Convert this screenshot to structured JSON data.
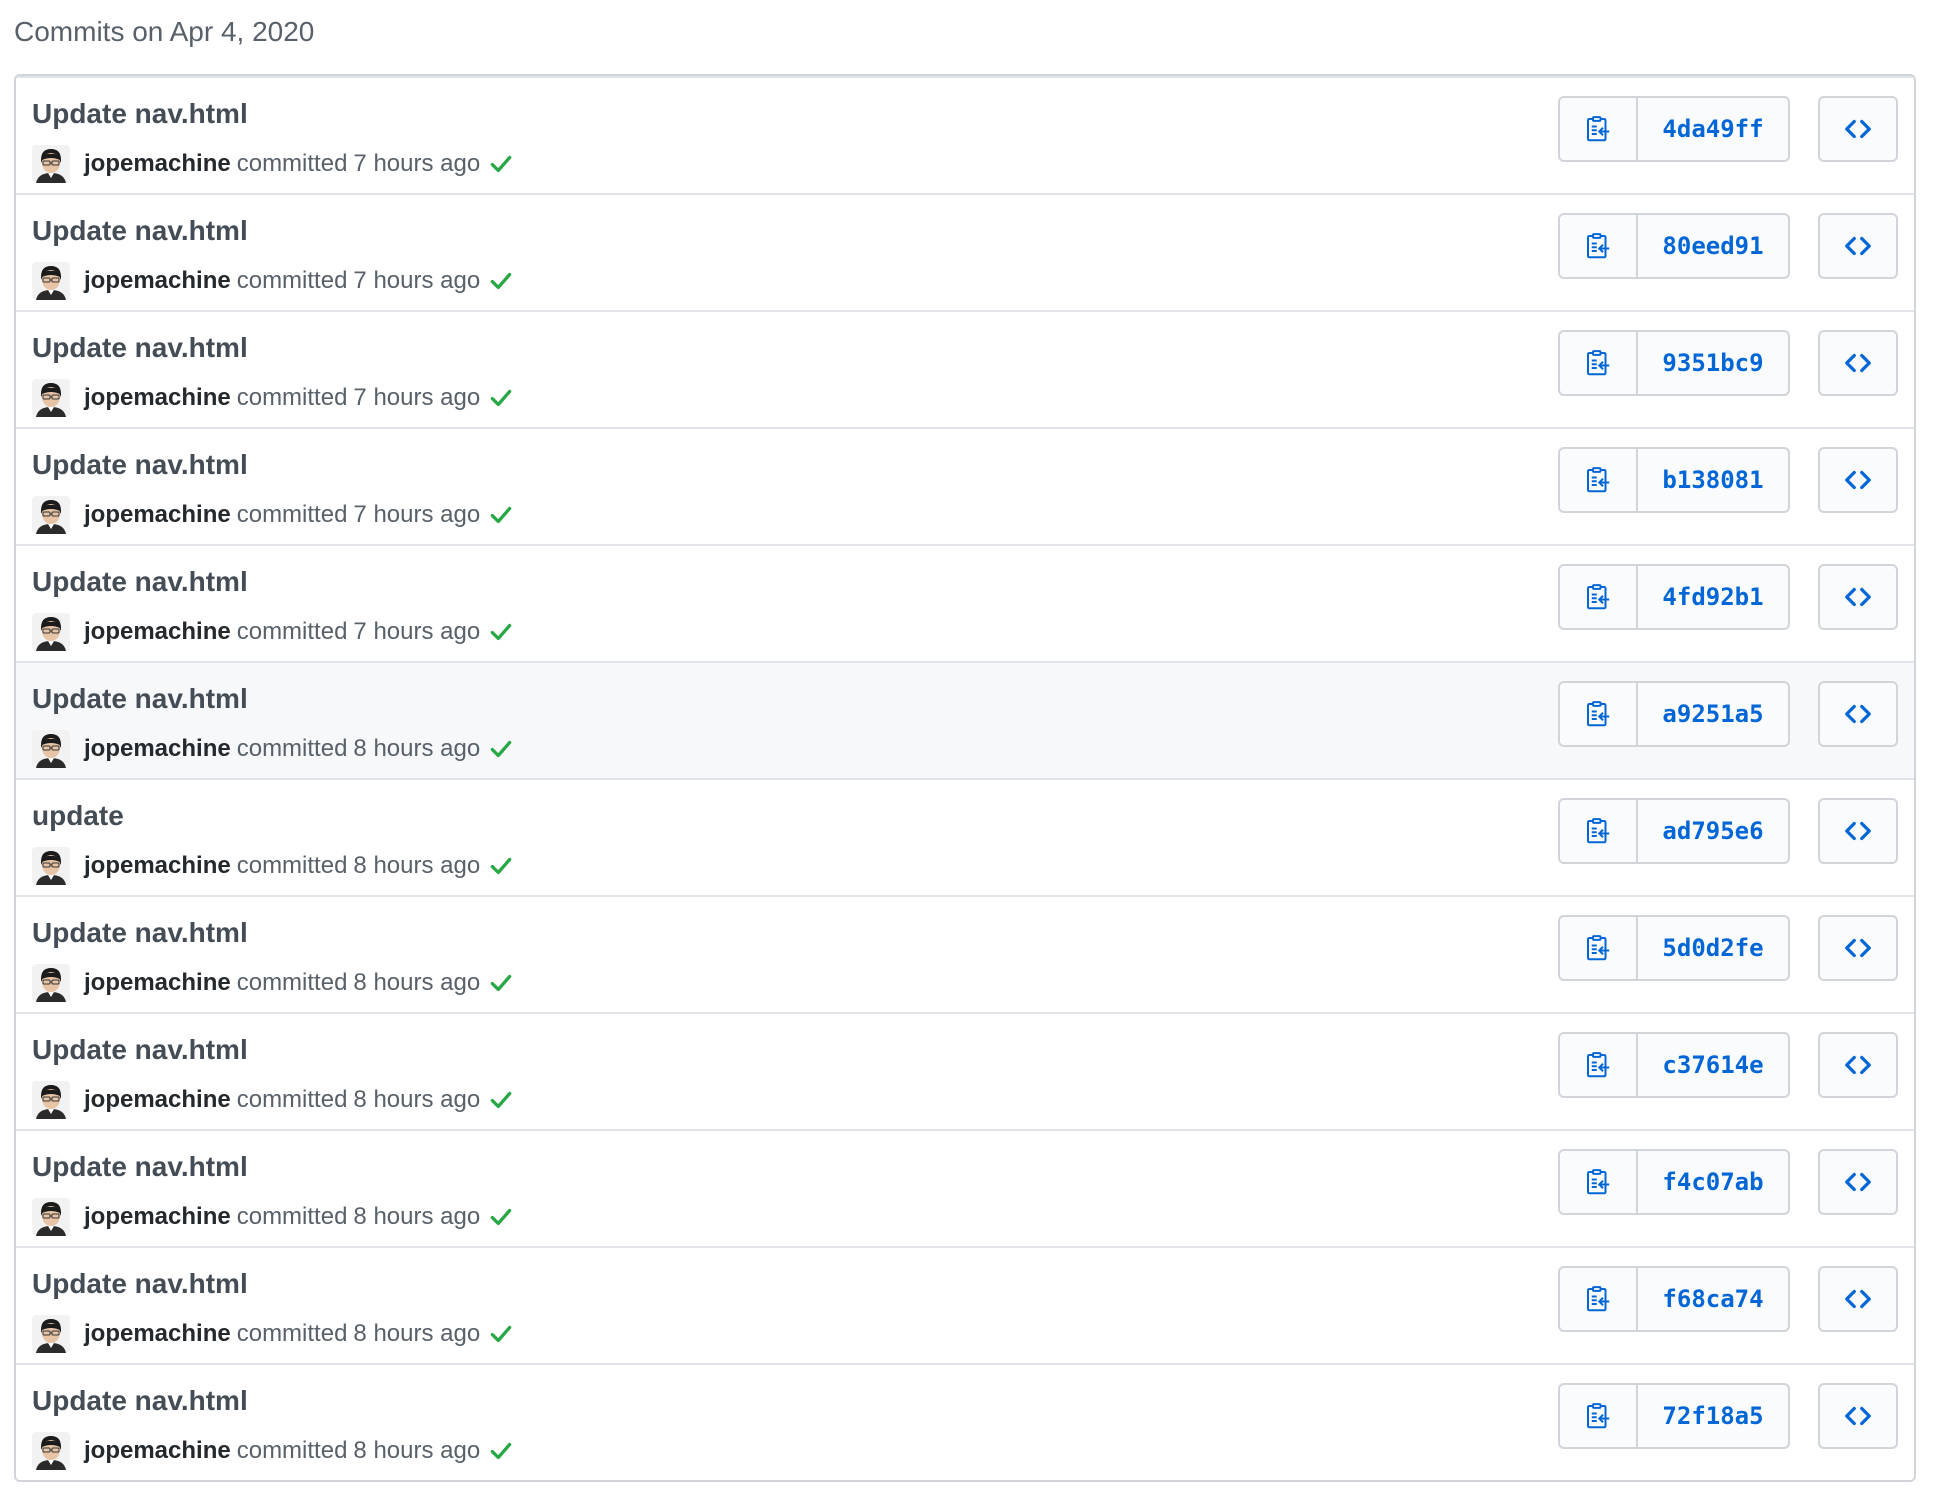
{
  "header": {
    "date_label": "Commits on Apr 4, 2020"
  },
  "colors": {
    "link": "#0366d6",
    "success": "#28a745",
    "border": "#d1d5da"
  },
  "icons": {
    "copy": "clippy-icon",
    "browse": "code-icon",
    "status": "check-icon"
  },
  "commits": [
    {
      "title": "Update nav.html",
      "author": "jopemachine",
      "action": "committed",
      "time": "7 hours ago",
      "sha": "4da49ff",
      "status": "success"
    },
    {
      "title": "Update nav.html",
      "author": "jopemachine",
      "action": "committed",
      "time": "7 hours ago",
      "sha": "80eed91",
      "status": "success"
    },
    {
      "title": "Update nav.html",
      "author": "jopemachine",
      "action": "committed",
      "time": "7 hours ago",
      "sha": "9351bc9",
      "status": "success"
    },
    {
      "title": "Update nav.html",
      "author": "jopemachine",
      "action": "committed",
      "time": "7 hours ago",
      "sha": "b138081",
      "status": "success"
    },
    {
      "title": "Update nav.html",
      "author": "jopemachine",
      "action": "committed",
      "time": "7 hours ago",
      "sha": "4fd92b1",
      "status": "success"
    },
    {
      "title": "Update nav.html",
      "author": "jopemachine",
      "action": "committed",
      "time": "8 hours ago",
      "sha": "a9251a5",
      "status": "success",
      "hovered": true
    },
    {
      "title": "update",
      "author": "jopemachine",
      "action": "committed",
      "time": "8 hours ago",
      "sha": "ad795e6",
      "status": "success"
    },
    {
      "title": "Update nav.html",
      "author": "jopemachine",
      "action": "committed",
      "time": "8 hours ago",
      "sha": "5d0d2fe",
      "status": "success"
    },
    {
      "title": "Update nav.html",
      "author": "jopemachine",
      "action": "committed",
      "time": "8 hours ago",
      "sha": "c37614e",
      "status": "success"
    },
    {
      "title": "Update nav.html",
      "author": "jopemachine",
      "action": "committed",
      "time": "8 hours ago",
      "sha": "f4c07ab",
      "status": "success"
    },
    {
      "title": "Update nav.html",
      "author": "jopemachine",
      "action": "committed",
      "time": "8 hours ago",
      "sha": "f68ca74",
      "status": "success"
    },
    {
      "title": "Update nav.html",
      "author": "jopemachine",
      "action": "committed",
      "time": "8 hours ago",
      "sha": "72f18a5",
      "status": "success"
    }
  ]
}
